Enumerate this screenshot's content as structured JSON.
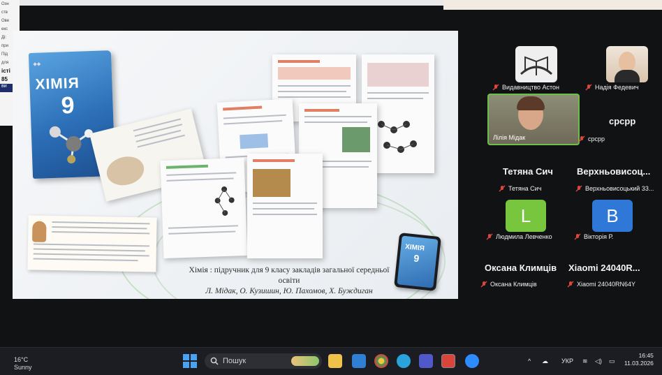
{
  "background_page": {
    "lines": [
      "Озн",
      "ств",
      "Ове",
      "екс",
      "Ді:",
      "при",
      "Під",
      "для"
    ],
    "bold_line": "істі",
    "bold_number": "85",
    "bar_text": "ви"
  },
  "slide": {
    "book_title": "ХІМІЯ",
    "book_grade": "9",
    "phone_title": "ХІМІЯ",
    "phone_grade": "9",
    "caption_title": "Хімія : підручник для 9 класу закладів загальної середньої освіти",
    "caption_authors": "Л. Мідак, О. Кузишин, Ю. Пахомов, Х. Буждиган"
  },
  "participants": [
    {
      "name": "Видавництво Астон",
      "avatar": "logo"
    },
    {
      "name": "Надія Федевич",
      "avatar": "photo"
    },
    {
      "name": "Лілія Мідак",
      "avatar": "video",
      "active_speaker": true
    },
    {
      "name": "срсрр",
      "display": "срсрр"
    },
    {
      "name": "Тетяна Сич",
      "display": "Тетяна Сич"
    },
    {
      "name": "Верхньовисоцький 33...",
      "display": "Верхньовисоц..."
    },
    {
      "name": "Людмила Левченко",
      "avatar_letter": "L",
      "color": "#78c63e"
    },
    {
      "name": "Вікторія Р.",
      "avatar_letter": "B",
      "color": "#2f78d8"
    },
    {
      "name": "Оксана Климців",
      "display": "Оксана Климців"
    },
    {
      "name": "Xiaomi 24040RN64Y",
      "display": "Xiaomi  24040R..."
    }
  ],
  "taskbar": {
    "temperature": "16°C",
    "weather": "Sunny",
    "search_placeholder": "Пошук",
    "language": "УКР",
    "time": "16:45",
    "date": "11.03.2026"
  },
  "colors": {
    "mic_off": "#e0453a",
    "speaker_border": "#6cc04a",
    "windows_blue": "#4aa3f0"
  }
}
